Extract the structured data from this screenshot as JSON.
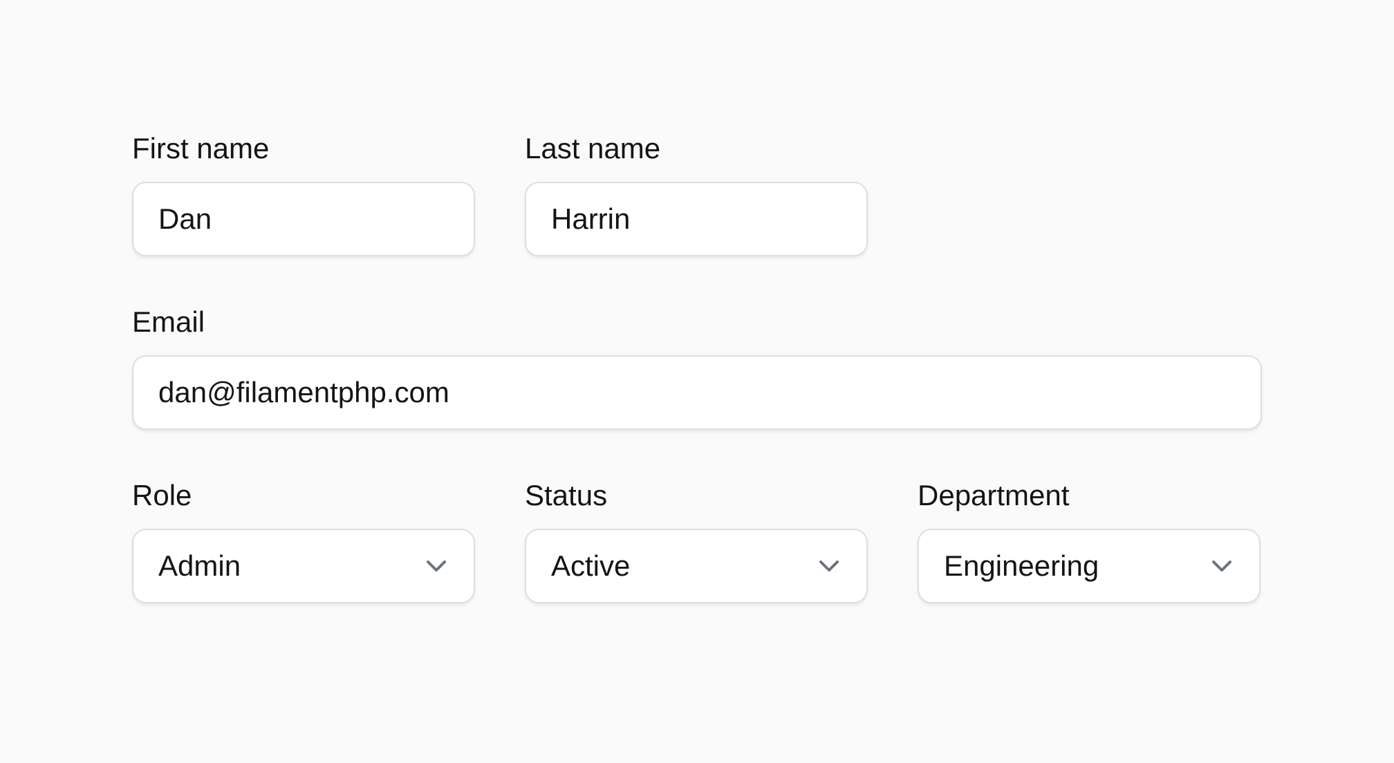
{
  "form": {
    "first_name": {
      "label": "First name",
      "value": "Dan"
    },
    "last_name": {
      "label": "Last name",
      "value": "Harrin"
    },
    "email": {
      "label": "Email",
      "value": "dan@filamentphp.com"
    },
    "role": {
      "label": "Role",
      "value": "Admin",
      "icon": "chevron-down-icon"
    },
    "status": {
      "label": "Status",
      "value": "Active",
      "icon": "chevron-down-icon"
    },
    "department": {
      "label": "Department",
      "value": "Engineering",
      "icon": "chevron-down-icon"
    }
  },
  "colors": {
    "background": "#fafafa",
    "input_background": "#ffffff",
    "input_border": "#dedede",
    "text": "#141414",
    "chevron": "#6b7280"
  }
}
